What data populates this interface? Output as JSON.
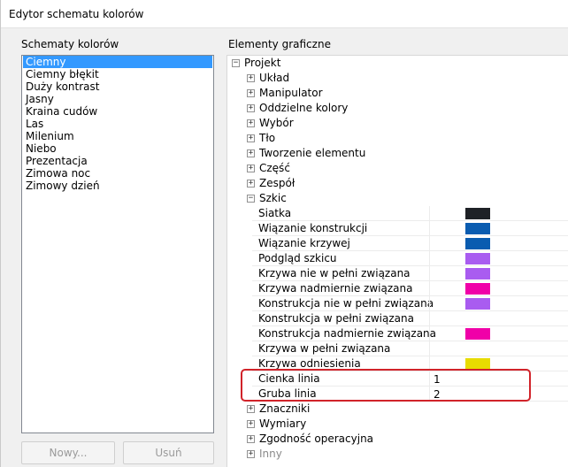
{
  "window": {
    "title": "Edytor schematu kolorów"
  },
  "left_panel": {
    "label": "Schematy kolorów",
    "schemes": [
      "Ciemny",
      "Ciemny błękit",
      "Duży kontrast",
      "Jasny",
      "Kraina cudów",
      "Las",
      "Milenium",
      "Niebo",
      "Prezentacja",
      "Zimowa noc",
      "Zimowy dzień"
    ],
    "selected_scheme": "Ciemny",
    "new_button": "Nowy...",
    "delete_button": "Usuń"
  },
  "right_panel": {
    "label": "Elementy graficzne",
    "root": "Projekt",
    "collapsed_before": [
      "Układ",
      "Manipulator",
      "Oddzielne kolory",
      "Wybór",
      "Tło",
      "Tworzenie elementu",
      "Część",
      "Zespół"
    ],
    "expanded": "Szkic",
    "sketch_items": [
      {
        "name": "Siatka",
        "color": "#1e2126"
      },
      {
        "name": "Wiązanie konstrukcji",
        "color": "#0a5cb0"
      },
      {
        "name": "Wiązanie krzywej",
        "color": "#0a5cb0"
      },
      {
        "name": "Podgląd szkicu",
        "color": "#a95cf0"
      },
      {
        "name": "Krzywa nie w pełni związana",
        "color": "#a95cf0"
      },
      {
        "name": "Krzywa nadmiernie związana",
        "color": "#f000a8"
      },
      {
        "name": "Konstrukcja nie w pełni związana",
        "color": "#a95cf0"
      },
      {
        "name": "Konstrukcja w pełni związana",
        "color": ""
      },
      {
        "name": "Konstrukcja nadmiernie związana",
        "color": "#f000a8"
      },
      {
        "name": "Krzywa w pełni związana",
        "color": ""
      },
      {
        "name": "Krzywa odniesienia",
        "color": "#e8dc00"
      },
      {
        "name": "Cienka linia",
        "value": "1"
      },
      {
        "name": "Gruba linia",
        "value": "2"
      }
    ],
    "collapsed_after": [
      "Znaczniki",
      "Wymiary",
      "Zgodność operacyjna",
      "Inny"
    ]
  },
  "colors": {
    "selection": "#3399ff",
    "highlight_border": "#d1232a"
  }
}
